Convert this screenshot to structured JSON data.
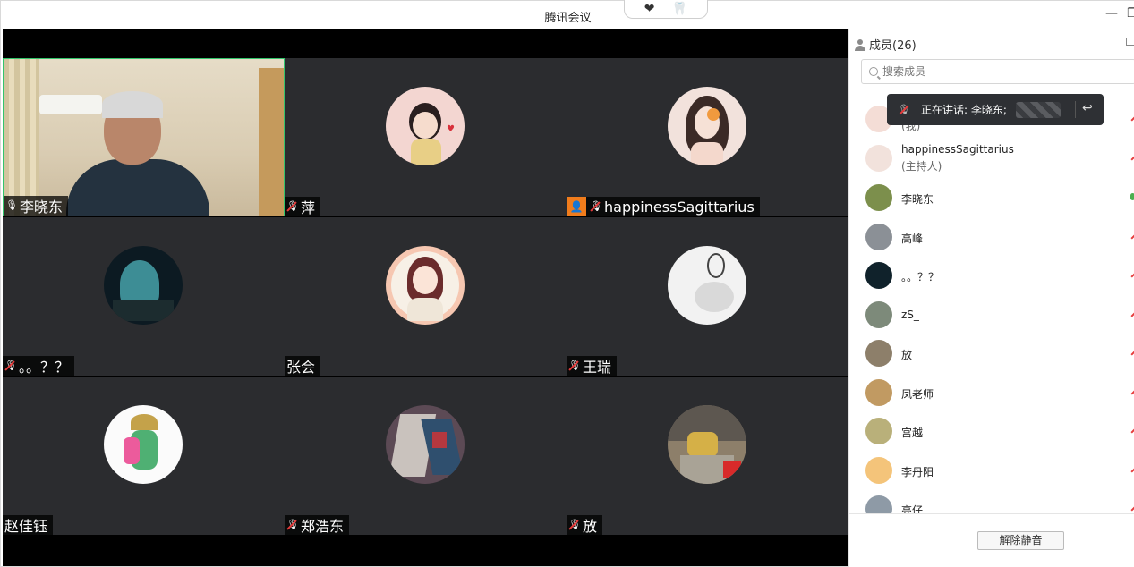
{
  "window": {
    "title": "腾讯会议",
    "reactions": [
      "❤",
      "🦷"
    ],
    "minimize": "—",
    "maximize": "❐"
  },
  "tiles": [
    {
      "name": "李晓东",
      "mic": "on",
      "type": "camera",
      "active": true
    },
    {
      "name": "萍",
      "mic": "muted",
      "type": "avatar",
      "color": "#f3d6d1"
    },
    {
      "name": "happinessSagittarius",
      "mic": "muted",
      "type": "avatar",
      "host_badge": true,
      "color": "#f2e2dc"
    },
    {
      "name": "。。？？",
      "mic": "muted",
      "type": "avatar",
      "color": "#0c1a22"
    },
    {
      "name": "张会",
      "mic": "none",
      "type": "avatar",
      "color": "#f6c7b1"
    },
    {
      "name": "王瑞",
      "mic": "muted",
      "type": "avatar",
      "color": "#f2f2f2"
    },
    {
      "name": "赵佳钰",
      "mic": "none",
      "type": "avatar",
      "color": "#fbfbfb"
    },
    {
      "name": "郑浩东",
      "mic": "muted",
      "type": "avatar",
      "color": "#5c4a55"
    },
    {
      "name": "放",
      "mic": "muted",
      "type": "avatar",
      "color": "#8d7f6a"
    }
  ],
  "sidebar": {
    "header": "成员(26)",
    "search_placeholder": "搜索成员",
    "members": [
      {
        "name": "",
        "sub": "(我)",
        "mic": "muted",
        "color": "#f4ddd6"
      },
      {
        "name": "happinessSagittarius",
        "sub": "(主持人)",
        "mic": "muted",
        "color": "#f2e2dc"
      },
      {
        "name": "李晓东",
        "sub": "",
        "mic": "on",
        "color": "#7c8f4c"
      },
      {
        "name": "高峰",
        "sub": "",
        "mic": "muted",
        "color": "#8b9096"
      },
      {
        "name": "。。？？",
        "sub": "",
        "mic": "muted",
        "color": "#10222b"
      },
      {
        "name": "zS_",
        "sub": "",
        "mic": "muted",
        "color": "#7d8a7a"
      },
      {
        "name": "放",
        "sub": "",
        "mic": "muted",
        "color": "#8d7f6a"
      },
      {
        "name": "凤老师",
        "sub": "",
        "mic": "muted",
        "color": "#c19a62"
      },
      {
        "name": "宫越",
        "sub": "",
        "mic": "muted",
        "color": "#b9b07a"
      },
      {
        "name": "李丹阳",
        "sub": "",
        "mic": "muted",
        "color": "#f4c47a"
      },
      {
        "name": "亮仔",
        "sub": "",
        "mic": "muted",
        "color": "#8e9aa6"
      }
    ],
    "speaking_label": "正在讲话: 李晓东;",
    "unmute_label": "解除静音"
  }
}
